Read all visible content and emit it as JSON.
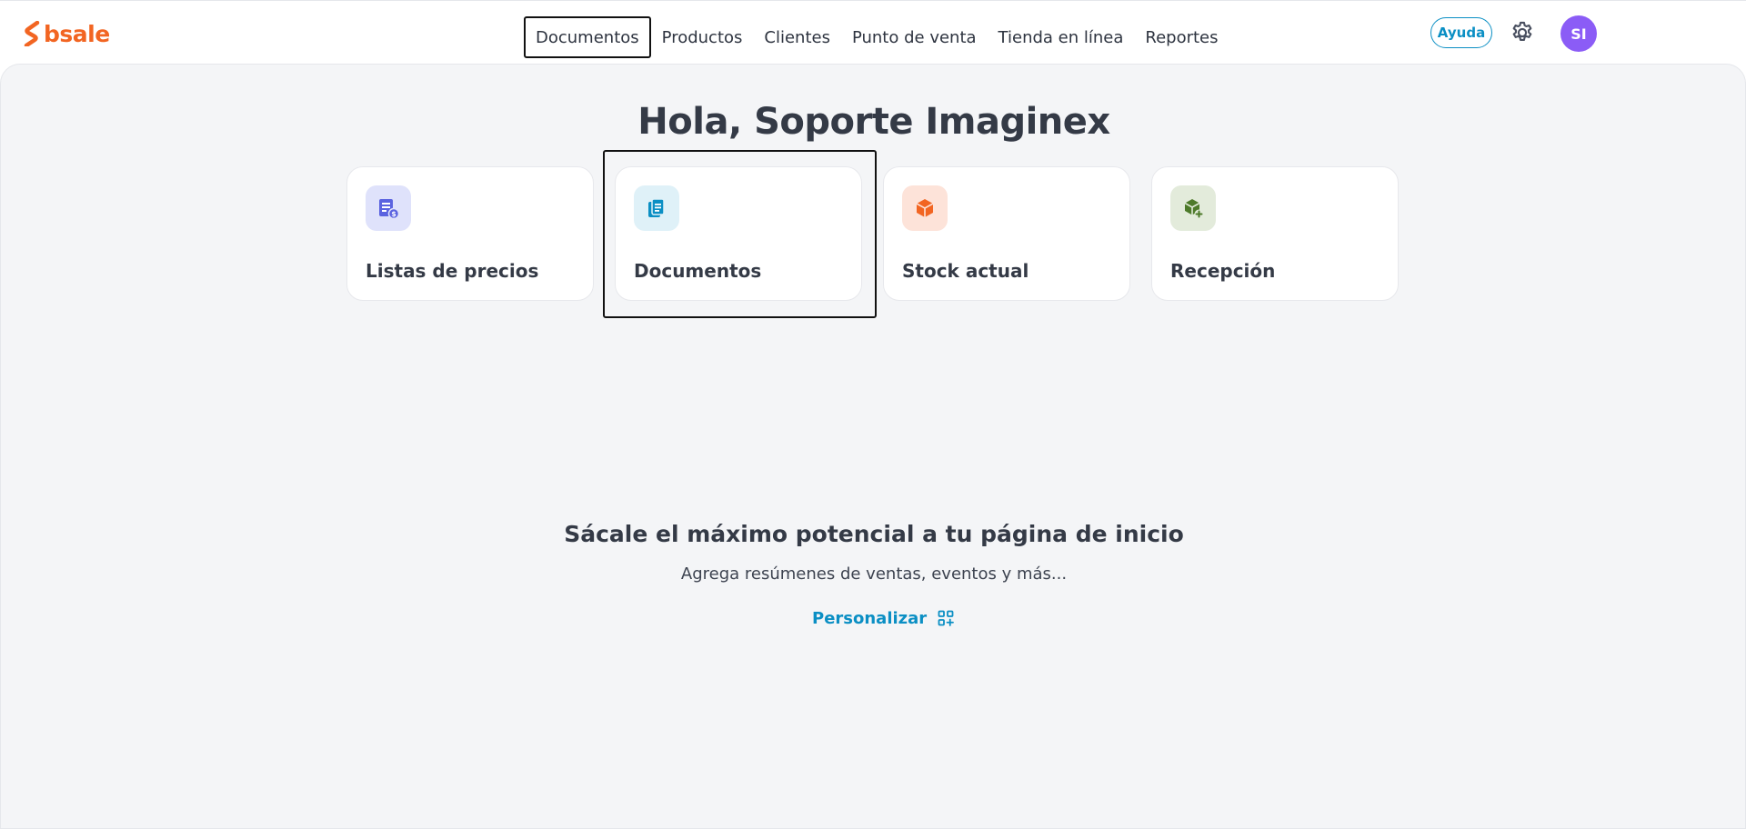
{
  "brand": {
    "name": "bsale",
    "color": "#f26522"
  },
  "nav": {
    "items": [
      {
        "label": "Documentos",
        "active": true
      },
      {
        "label": "Productos"
      },
      {
        "label": "Clientes"
      },
      {
        "label": "Punto de venta"
      },
      {
        "label": "Tienda en línea"
      },
      {
        "label": "Reportes"
      }
    ]
  },
  "header": {
    "help_label": "Ayuda",
    "settings_icon": "gear-icon",
    "avatar_initials": "SI"
  },
  "main": {
    "greeting": "Hola, Soporte Imaginex",
    "shortcuts": [
      {
        "label": "Listas de precios",
        "icon": "price-list-icon",
        "bg": "#dfe2fb",
        "fg": "#5b63e0"
      },
      {
        "label": "Documentos",
        "icon": "document-icon",
        "bg": "#dff1f8",
        "fg": "#0b8fc4"
      },
      {
        "label": "Stock actual",
        "icon": "box-icon",
        "bg": "#fde3d9",
        "fg": "#f26522"
      },
      {
        "label": "Recepción",
        "icon": "box-add-icon",
        "bg": "#e3ebdb",
        "fg": "#4d7a2a"
      }
    ],
    "promo": {
      "title": "Sácale el máximo potencial a tu página de inicio",
      "subtitle": "Agrega resúmenes de ventas, eventos y más...",
      "action_label": "Personalizar",
      "action_icon": "widgets-add-icon"
    }
  }
}
